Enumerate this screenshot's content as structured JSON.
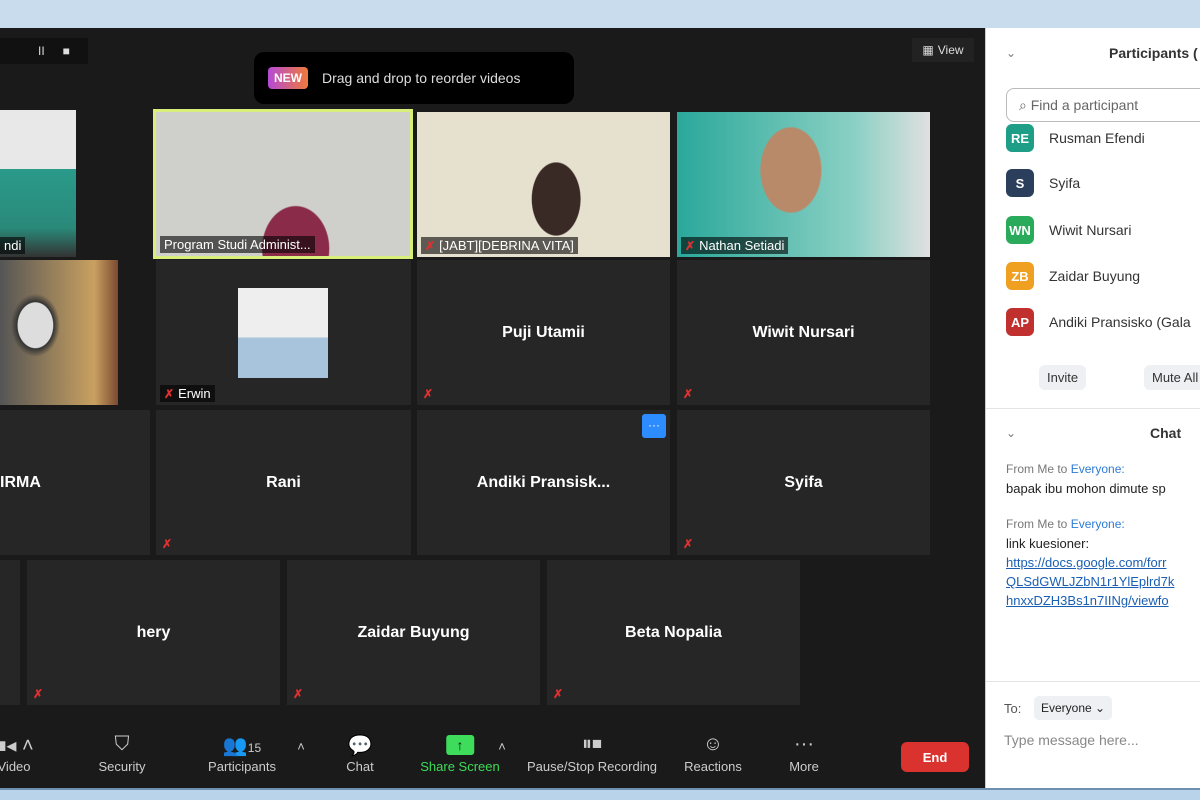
{
  "recording_controls": {
    "pause": "II",
    "stop": "■"
  },
  "view_button": {
    "icon": "grid-icon",
    "label": "View"
  },
  "toast": {
    "badge": "NEW",
    "text": "Drag and drop to reorder videos"
  },
  "tiles": [
    {
      "label": "ndi",
      "video": true,
      "muted": false
    },
    {
      "label": "Program Studi Administ...",
      "video": true,
      "active_speaker": true,
      "muted": false
    },
    {
      "label": "[JABT][DEBRINA VITA]",
      "video": true,
      "muted": true
    },
    {
      "label": "Nathan Setiadi",
      "video": true,
      "muted": true
    },
    {
      "label": "",
      "video": true,
      "muted": false
    },
    {
      "label": "Erwin",
      "video": false,
      "photo": true,
      "muted": true
    },
    {
      "name": "Puji Utamii",
      "muted": true
    },
    {
      "name": "Wiwit Nursari",
      "muted": true
    },
    {
      "name": "IRMA",
      "muted": false
    },
    {
      "name": "Rani",
      "muted": true
    },
    {
      "name": "Andiki  Pransisk...",
      "muted": false,
      "more_button": "···"
    },
    {
      "name": "Syifa",
      "muted": true
    },
    {
      "name": "hery",
      "muted": true
    },
    {
      "name": "Zaidar Buyung",
      "muted": true
    },
    {
      "name": "Beta Nopalia",
      "muted": true
    }
  ],
  "toolbar": {
    "video": "Video",
    "security": "Security",
    "participants": "Participants",
    "participant_count": "15",
    "chat": "Chat",
    "share_screen": "Share Screen",
    "recording": "Pause/Stop Recording",
    "reactions": "Reactions",
    "more": "More",
    "end": "End"
  },
  "participants_panel": {
    "title": "Participants (",
    "search_placeholder": "Find a participant",
    "items": [
      {
        "initials": "RE",
        "name": "Rusman Efendi",
        "color": "#1f9e87"
      },
      {
        "initials": "S",
        "name": "Syifa",
        "color": "#2b3f5c"
      },
      {
        "initials": "WN",
        "name": "Wiwit Nursari",
        "color": "#2aab5b"
      },
      {
        "initials": "ZB",
        "name": "Zaidar Buyung",
        "color": "#f0a020"
      },
      {
        "initials": "AP",
        "name": "Andiki Pransisko (Gala",
        "color": "#c0302e"
      }
    ],
    "invite": "Invite",
    "mute_all": "Mute All"
  },
  "chat_panel": {
    "title": "Chat",
    "messages": [
      {
        "from": "From Me to ",
        "to": "Everyone:",
        "lines": [
          "bapak ibu mohon dimute sp"
        ]
      },
      {
        "from": "From Me to ",
        "to": "Everyone:",
        "lines": [
          "link kuesioner:"
        ],
        "links": [
          "https://docs.google.com/forr",
          "QLSdGWLJZbN1r1YlEplrd7k",
          "hnxxDZH3Bs1n7IINg/viewfo"
        ]
      }
    ],
    "to_label": "To:",
    "recipient": "Everyone",
    "input_placeholder": "Type message here..."
  }
}
